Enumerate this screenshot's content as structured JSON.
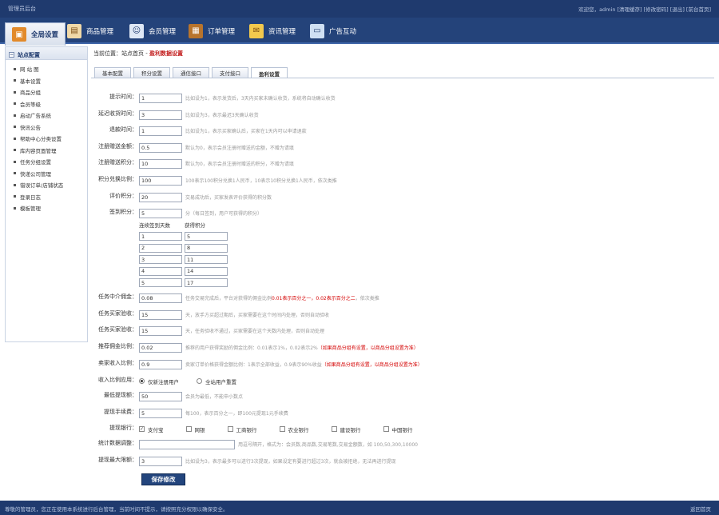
{
  "header": {
    "logo": "管理员后台",
    "links": "欢迎您，admin [清理缓存] [修改密码] [退出] [前台首页]"
  },
  "nav": [
    {
      "label": "全局设置",
      "icon": "settings-icon",
      "active": true
    },
    {
      "label": "商品管理",
      "icon": "goods-icon"
    },
    {
      "label": "会员管理",
      "icon": "members-icon"
    },
    {
      "label": "订单管理",
      "icon": "orders-icon"
    },
    {
      "label": "资讯管理",
      "icon": "news-icon"
    },
    {
      "label": "广告互动",
      "icon": "ads-icon"
    }
  ],
  "sidebar": {
    "title": "站点配置",
    "items": [
      "网 站 图",
      "基本设置",
      "商品分组",
      "会员等级",
      "启动广告系统",
      "快讯公告",
      "帮助中心分类设置",
      "库内容页面管理",
      "任务分组设置",
      "快递公司管理",
      "错误订单/店铺状态",
      "登录日志",
      "模板管理"
    ]
  },
  "breadcrumb": {
    "prefix": "当前位置：",
    "home": "站点首页",
    "sep": " - ",
    "current": "盈利数据设置"
  },
  "tabs": [
    "基本配置",
    "积分设置",
    "通信接口",
    "支付接口",
    "盈利设置"
  ],
  "form": {
    "rows1": [
      {
        "label": "提示时间：",
        "value": "1",
        "hint": "比如设为1，表示发货后，3天内买家未确认收货，系统将自动确认收货"
      },
      {
        "label": "延迟收货时间：",
        "value": "3",
        "hint": "比如设为3，表示最迟3天确认收货"
      },
      {
        "label": "退款时间：",
        "value": "1",
        "hint": "比如设为1，表示买家确认后，买家在1天内可以申请退款"
      },
      {
        "label": "注册赠送金额：",
        "value": "0.5",
        "hint": "默认为0，表示会员注册时赠送的金额，不赠为请填"
      },
      {
        "label": "注册赠送积分：",
        "value": "10",
        "hint": "默认为0，表示会员注册时赠送的积分，不赠为请填"
      },
      {
        "label": "积分兑换比例：",
        "value": "100",
        "hint": "100表示100积分兑换1人民币，10表示10积分兑换1人民币，依次类推"
      },
      {
        "label": "评价积分：",
        "value": "20",
        "hint": "交易成功后，买家发表评价获得的积分数"
      },
      {
        "label": "签到积分：",
        "value": "5",
        "hint": "分（每日签到，用户可获得的积分）"
      }
    ],
    "table": {
      "headers": [
        "连续签到天数",
        "获得积分"
      ],
      "rows": [
        [
          "1",
          "5"
        ],
        [
          "2",
          "8"
        ],
        [
          "3",
          "11"
        ],
        [
          "4",
          "14"
        ],
        [
          "5",
          "17"
        ]
      ]
    },
    "rows2": [
      {
        "label": "任务中介佣金：",
        "value": "0.08",
        "hint": "任务交易完成后，平台对获得的佣金比例",
        "red": "0.01表示百分之一，0.02表示百分之二",
        "hint2": "，依次类推"
      },
      {
        "label": "任务买家验收：",
        "value": "15",
        "hint": "天，放手方买超过期后，买家需要在这个时间内处理，否则自动验收"
      },
      {
        "label": "任务买家验收：",
        "value": "15",
        "hint": "天，任务验收不通过，买家需要在这个天数内处理，否则自动处理"
      },
      {
        "label": "推荐佣金比例：",
        "value": "0.02",
        "hint": "推荐的用户获得奖励的佣金比例：0.01表示1%，0.02表示2%",
        "red": "（如果商品分组有设置，以商品分组设置为准）",
        "hint2": ""
      },
      {
        "label": "卖家收入比例：",
        "value": "0.9",
        "hint": "卖家订单价格获得金额比例：1表示全部收益，0.9表示90%收益",
        "red": "（如果商品分组有设置，以商品分组设置为准）",
        "hint2": ""
      }
    ],
    "income": {
      "label": "收入比例应用：",
      "options": [
        "仅新注册用户",
        "全站用户重置"
      ],
      "selected": 0
    },
    "rows3": [
      {
        "label": "最低提现额：",
        "value": "50",
        "hint": "会员为最低，不能申小数点"
      },
      {
        "label": "提现手续费：",
        "value": "5",
        "hint": "每100，表示百分之一，即100元提现1元手续费"
      }
    ],
    "banks": {
      "label": "提现银行：",
      "items": [
        "支付宝",
        "网银",
        "工商银行",
        "农业银行",
        "建设银行",
        "中国银行"
      ],
      "checked": [
        0
      ]
    },
    "stats": {
      "label": "统计数据调整：",
      "value": "",
      "hint": "用逗号隔开，格式为：会员数,商品数,交易笔数,交易金额数，如 100,50,300,10000"
    },
    "maxwd": {
      "label": "提现最大限额：",
      "value": "3",
      "hint": "比如设为3，表示最多可以进行3次提现，如果设定有要进行超过3次，就会被拒绝，无法再进行提现"
    },
    "save": "保存修改"
  },
  "footer": {
    "left": "尊敬的管理员，您正在使用本系统进行后台管理，当前时间不提示，请按照充分权限以确保安全。",
    "right": "返回首页"
  }
}
